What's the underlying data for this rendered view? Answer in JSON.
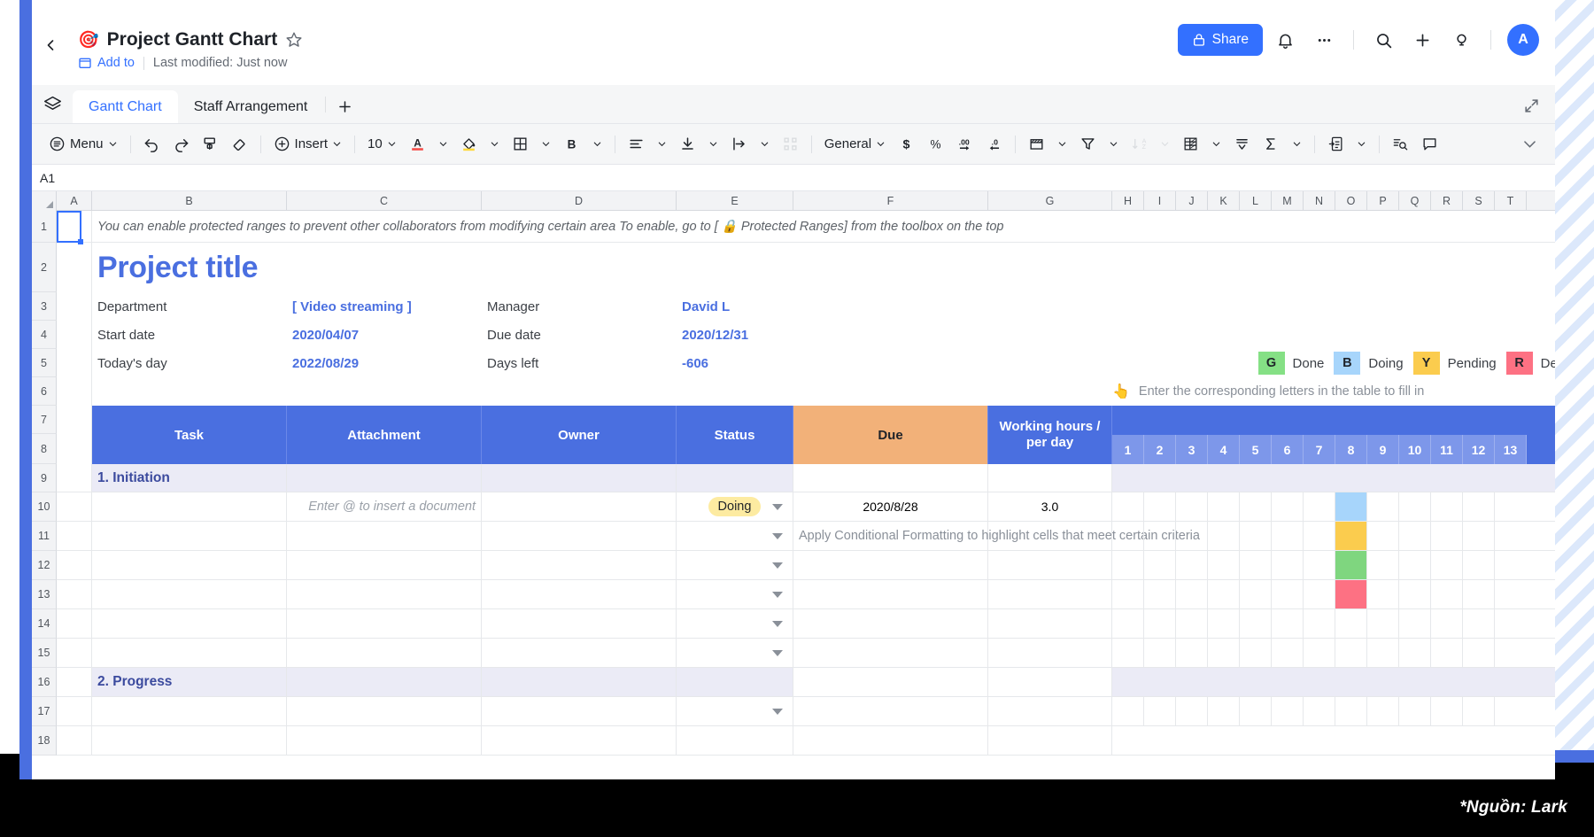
{
  "header": {
    "doc_emoji": "🎯",
    "title": "Project Gantt Chart",
    "add_to": "Add to",
    "last_modified": "Last modified: Just now",
    "share_label": "Share",
    "avatar_initial": "A"
  },
  "tabs": {
    "items": [
      {
        "label": "Gantt Chart",
        "active": true
      },
      {
        "label": "Staff Arrangement",
        "active": false
      }
    ],
    "add_label": "+"
  },
  "toolbar": {
    "menu_label": "Menu",
    "insert_label": "Insert",
    "font_size": "10",
    "number_format": "General"
  },
  "namebox": {
    "value": "A1"
  },
  "grid": {
    "col_headers": [
      "A",
      "B",
      "C",
      "D",
      "E",
      "F",
      "G",
      "H",
      "I",
      "J",
      "K",
      "L",
      "M",
      "N",
      "O",
      "P",
      "Q",
      "R",
      "S",
      "T"
    ],
    "row_headers": [
      "1",
      "2",
      "3",
      "4",
      "5",
      "6",
      "7",
      "8",
      "9",
      "10",
      "11",
      "12",
      "13",
      "14",
      "15",
      "16",
      "17",
      "18"
    ]
  },
  "sheet": {
    "protected_hint": "You can enable protected ranges to prevent other collaborators from modifying certain area To enable, go to [ 🔒 Protected Ranges] from the toolbox on the top",
    "project_title": "Project title",
    "fields": [
      {
        "label": "Department",
        "value": "[ Video streaming ]"
      },
      {
        "label": "Start date",
        "value": "2020/04/07"
      },
      {
        "label": "Today's day",
        "value": "2022/08/29"
      }
    ],
    "fields2": [
      {
        "label": "Manager",
        "value": "David L"
      },
      {
        "label": "Due date",
        "value": "2020/12/31"
      },
      {
        "label": "Days left",
        "value": "-606"
      }
    ],
    "legend": [
      {
        "letter": "G",
        "text": "Done",
        "color": "#85e085"
      },
      {
        "letter": "B",
        "text": "Doing",
        "color": "#a7d5fb"
      },
      {
        "letter": "Y",
        "text": "Pending",
        "color": "#fbcc4e"
      },
      {
        "letter": "R",
        "text": "Delay",
        "color": "#fd7183"
      }
    ],
    "legend_hint_icon": "👆",
    "legend_hint": "Enter the corresponding letters in the table to fill in",
    "table_headers": [
      "Task",
      "Attachment",
      "Owner",
      "Status",
      "Due",
      "Working hours /\nper day"
    ],
    "table_header_working": {
      "line1": "Working hours /",
      "line2": "per day"
    },
    "day_columns": [
      "1",
      "2",
      "3",
      "4",
      "5",
      "6",
      "7",
      "8",
      "9",
      "10",
      "11",
      "12",
      "13"
    ],
    "sections": [
      {
        "name": "1. Initiation",
        "row": 9
      },
      {
        "name": "2. Progress",
        "row": 16
      }
    ],
    "rows": [
      {
        "row": 10,
        "attachment_placeholder": "Enter @ to insert a document",
        "status": "Doing",
        "due": "2020/8/28",
        "working_hours": "3.0",
        "bar_day": 8,
        "bar_color": "#a7d5fb"
      },
      {
        "row": 11,
        "note": "Apply Conditional Formatting to highlight cells that meet certain criteria",
        "bar_day": 8,
        "bar_color": "#fbcc4e"
      },
      {
        "row": 12,
        "bar_day": 8,
        "bar_color": "#7fd67f"
      },
      {
        "row": 13,
        "bar_day": 8,
        "bar_color": "#fd7183"
      },
      {
        "row": 14
      },
      {
        "row": 15
      },
      {
        "row": 17
      }
    ]
  },
  "watermark": "*Nguồn: Lark"
}
